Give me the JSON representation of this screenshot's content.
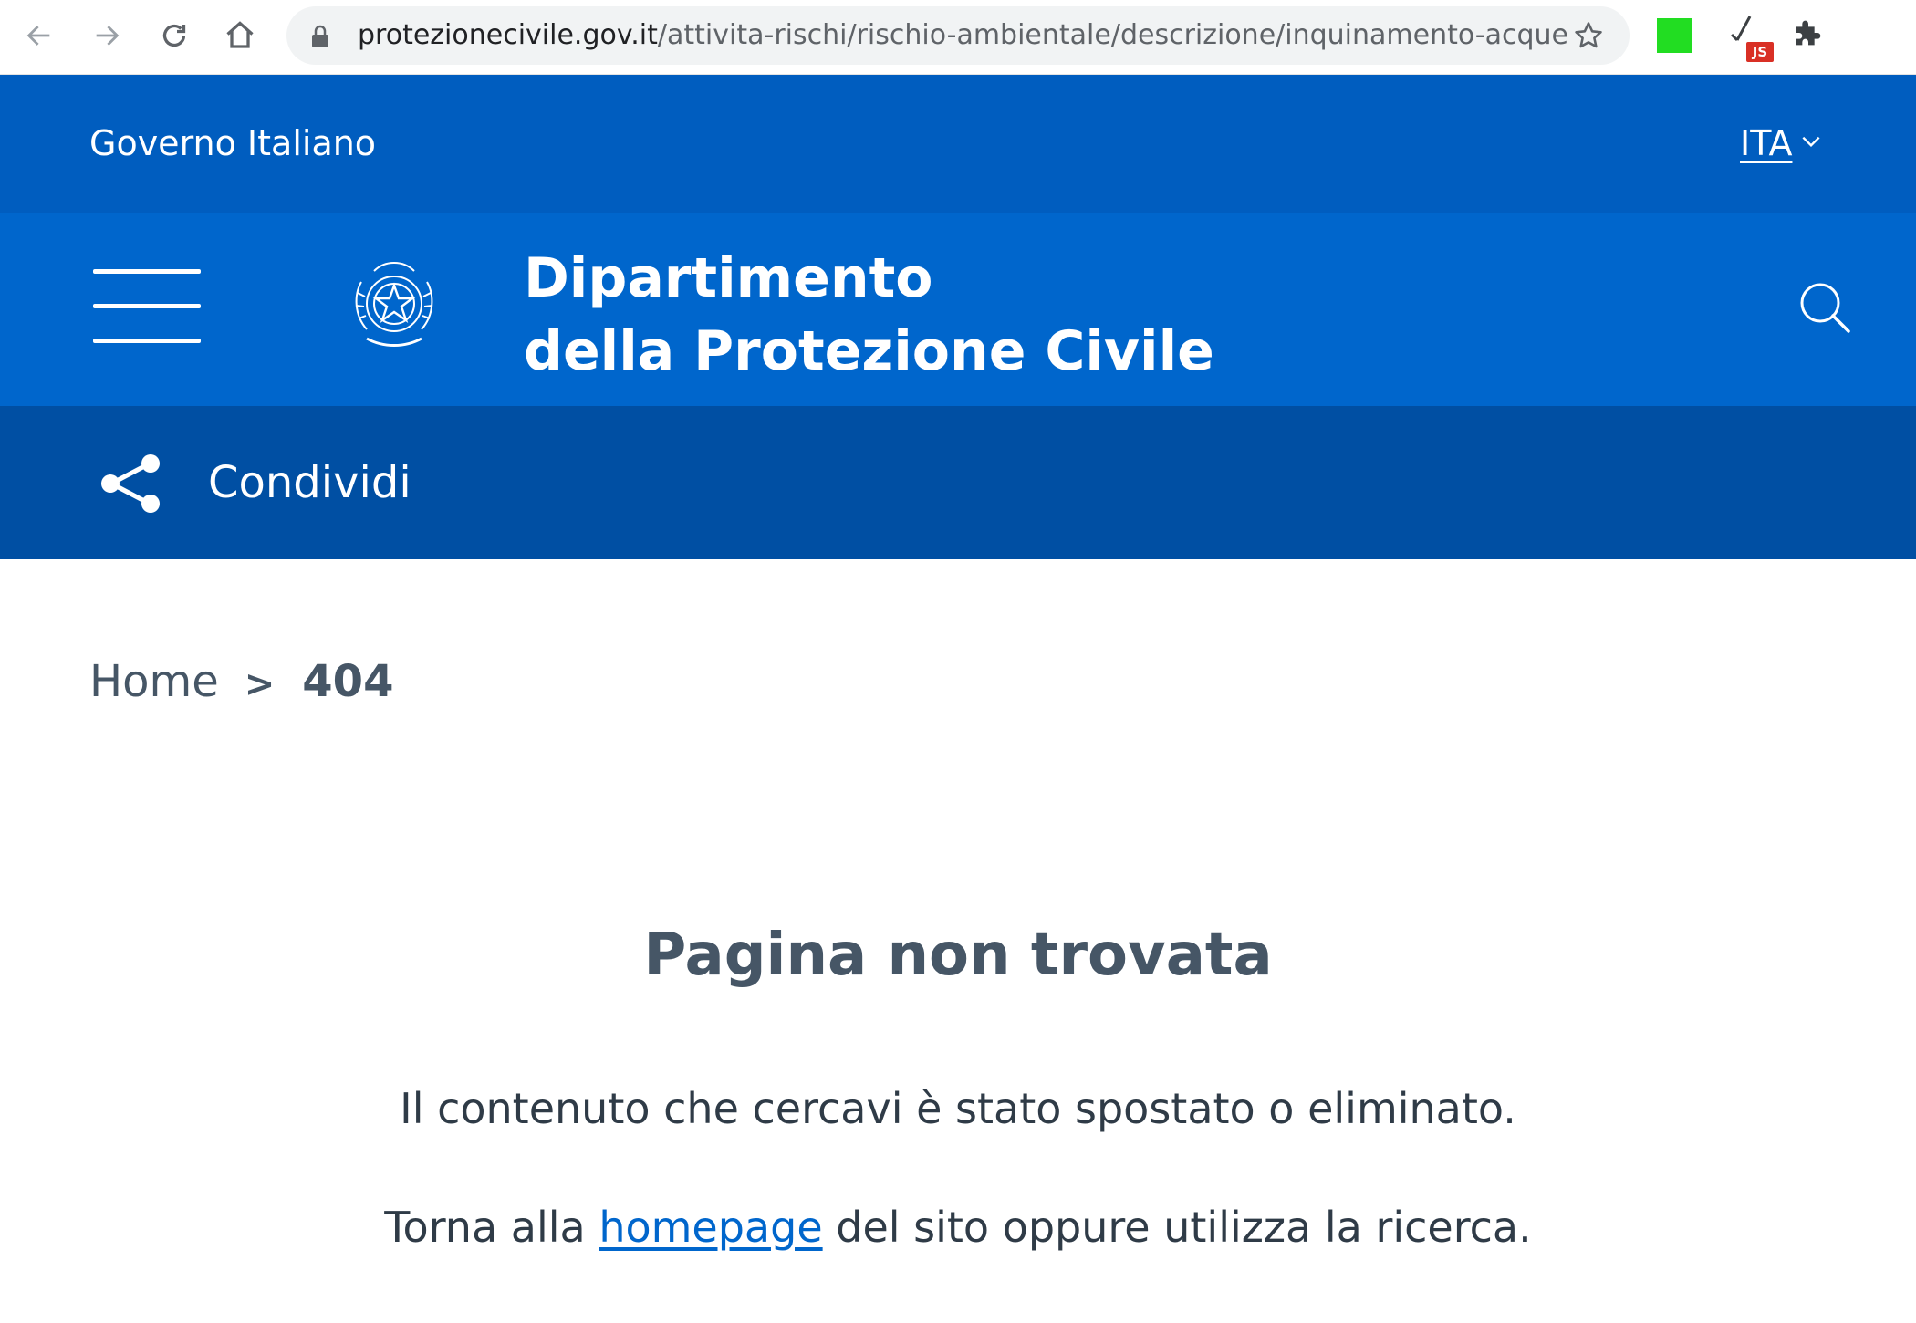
{
  "browser": {
    "url_host": "protezionecivile.gov.it",
    "url_path": "/attivita-rischi/rischio-ambientale/descrizione/inquinamento-acque",
    "extension_js_badge": "JS"
  },
  "header": {
    "government_label": "Governo Italiano",
    "language": "ITA",
    "brand_line1": "Dipartimento",
    "brand_line2": "della Protezione Civile",
    "brand_color": "#0066cc",
    "slim_color": "#005dbf"
  },
  "share": {
    "label": "Condividi"
  },
  "breadcrumb": {
    "home": "Home",
    "separator": ">",
    "current": "404"
  },
  "content": {
    "title": "Pagina non trovata",
    "message": "Il contenuto che cercavi è stato spostato o eliminato.",
    "back_prefix": "Torna alla ",
    "homepage_link": "homepage",
    "back_suffix": " del sito oppure utilizza la ricerca."
  }
}
